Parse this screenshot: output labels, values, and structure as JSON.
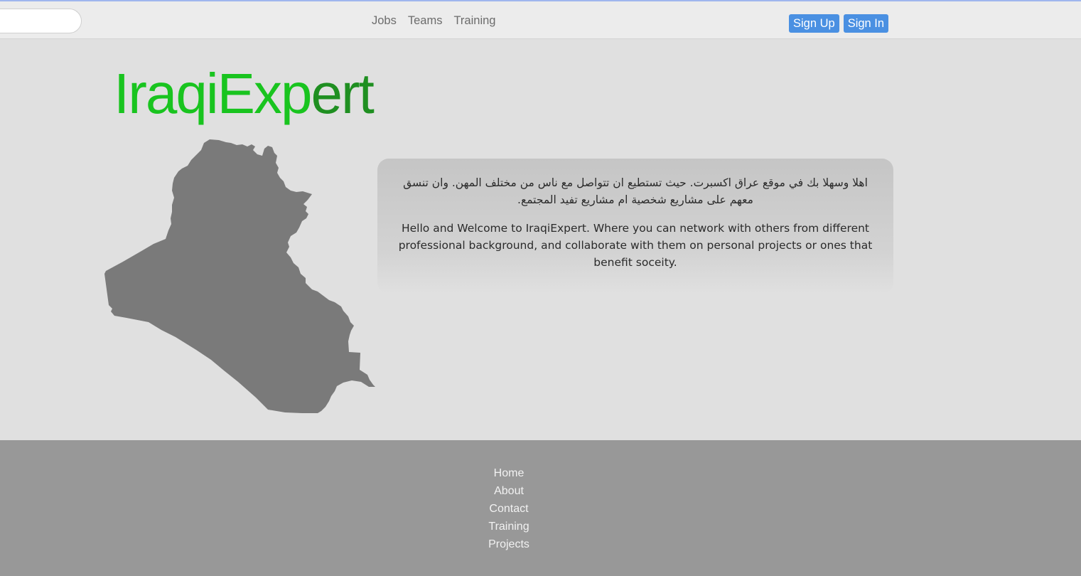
{
  "header": {
    "search": {
      "placeholder": "",
      "value": ""
    },
    "nav": [
      {
        "label": "Jobs"
      },
      {
        "label": "Teams"
      },
      {
        "label": "Training"
      }
    ],
    "auth": {
      "sign_up": "Sign Up",
      "sign_in": "Sign In"
    }
  },
  "hero": {
    "logo_part1": "IraqiExp",
    "logo_part2": "ert",
    "logo_colors": {
      "start": "#19c41f",
      "end": "#1f8f21"
    },
    "map_icon": "iraq-map",
    "map_color": "#7a7a7a",
    "welcome_ar": "اهلا وسهلا بك في موقع عراق اكسبرت. حيث تستطيع ان تتواصل مع ناس من مختلف المهن. وان تنسق معهم على مشاريع شخصية ام مشاريع تفيد المجتمع.",
    "welcome_en": "Hello and Welcome to IraqiExpert. Where you can network with others from different professional background, and collaborate with them on personal projects or ones that benefit soceity."
  },
  "footer": {
    "links": [
      {
        "label": "Home"
      },
      {
        "label": "About"
      },
      {
        "label": "Contact"
      },
      {
        "label": "Training"
      },
      {
        "label": "Projects"
      }
    ]
  },
  "colors": {
    "accent": "#4a90e2",
    "footer_bg": "#989898",
    "page_bg": "#e0e0e0"
  }
}
